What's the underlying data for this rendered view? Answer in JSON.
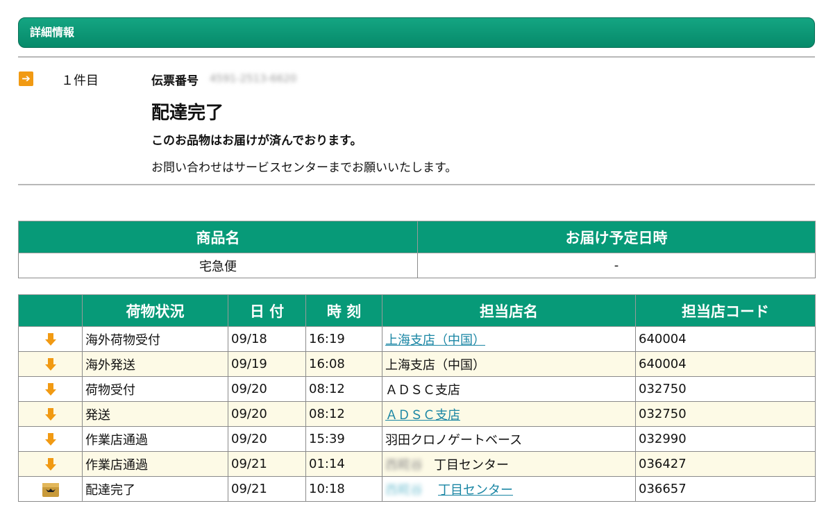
{
  "section": {
    "title": "詳細情報"
  },
  "shipment": {
    "item_count": "１件目",
    "denpyo_label": "伝票番号",
    "denpyo_number": "4591-2513-6620",
    "status_title": "配達完了",
    "status_message": "このお品物はお届けが済んでおります。",
    "contact_note": "お問い合わせはサービスセンターまでお願いいたします。"
  },
  "product_table": {
    "headers": [
      "商品名",
      "お届け予定日時"
    ],
    "row": [
      "宅急便",
      "-"
    ]
  },
  "history_table": {
    "headers": [
      "",
      "荷物状況",
      "日 付",
      "時 刻",
      "担当店名",
      "担当店コード"
    ],
    "rows": [
      {
        "status": "海外荷物受付",
        "date": "09/18",
        "time": "16:19",
        "store_prefix": "",
        "store": "上海支店（中国）",
        "code": "640004",
        "icon": "down-arrow-icon"
      },
      {
        "status": "海外発送",
        "date": "09/19",
        "time": "16:08",
        "store_prefix": "",
        "store": "上海支店（中国）",
        "code": "640004",
        "icon": "down-arrow-icon"
      },
      {
        "status": "荷物受付",
        "date": "09/20",
        "time": "08:12",
        "store_prefix": "",
        "store": "ＡＤＳＣ支店",
        "code": "032750",
        "icon": "down-arrow-icon"
      },
      {
        "status": "発送",
        "date": "09/20",
        "time": "08:12",
        "store_prefix": "",
        "store": "ＡＤＳＣ支店",
        "code": "032750",
        "icon": "down-arrow-icon"
      },
      {
        "status": "作業店通過",
        "date": "09/20",
        "time": "15:39",
        "store_prefix": "",
        "store": "羽田クロノゲートベース",
        "code": "032990",
        "icon": "down-arrow-icon"
      },
      {
        "status": "作業店通過",
        "date": "09/21",
        "time": "01:14",
        "store_prefix": "西糀谷",
        "store": "丁目センター",
        "code": "036427",
        "icon": "down-arrow-icon"
      },
      {
        "status": "配達完了",
        "date": "09/21",
        "time": "10:18",
        "store_prefix": "西糀谷",
        "store": "丁目センター",
        "code": "036657",
        "icon": "delivered-box-icon"
      }
    ]
  },
  "colors": {
    "header_green": "#079a78",
    "accent_orange": "#f19a13",
    "link": "#1a86a4",
    "alt_row": "#fdfae6"
  }
}
